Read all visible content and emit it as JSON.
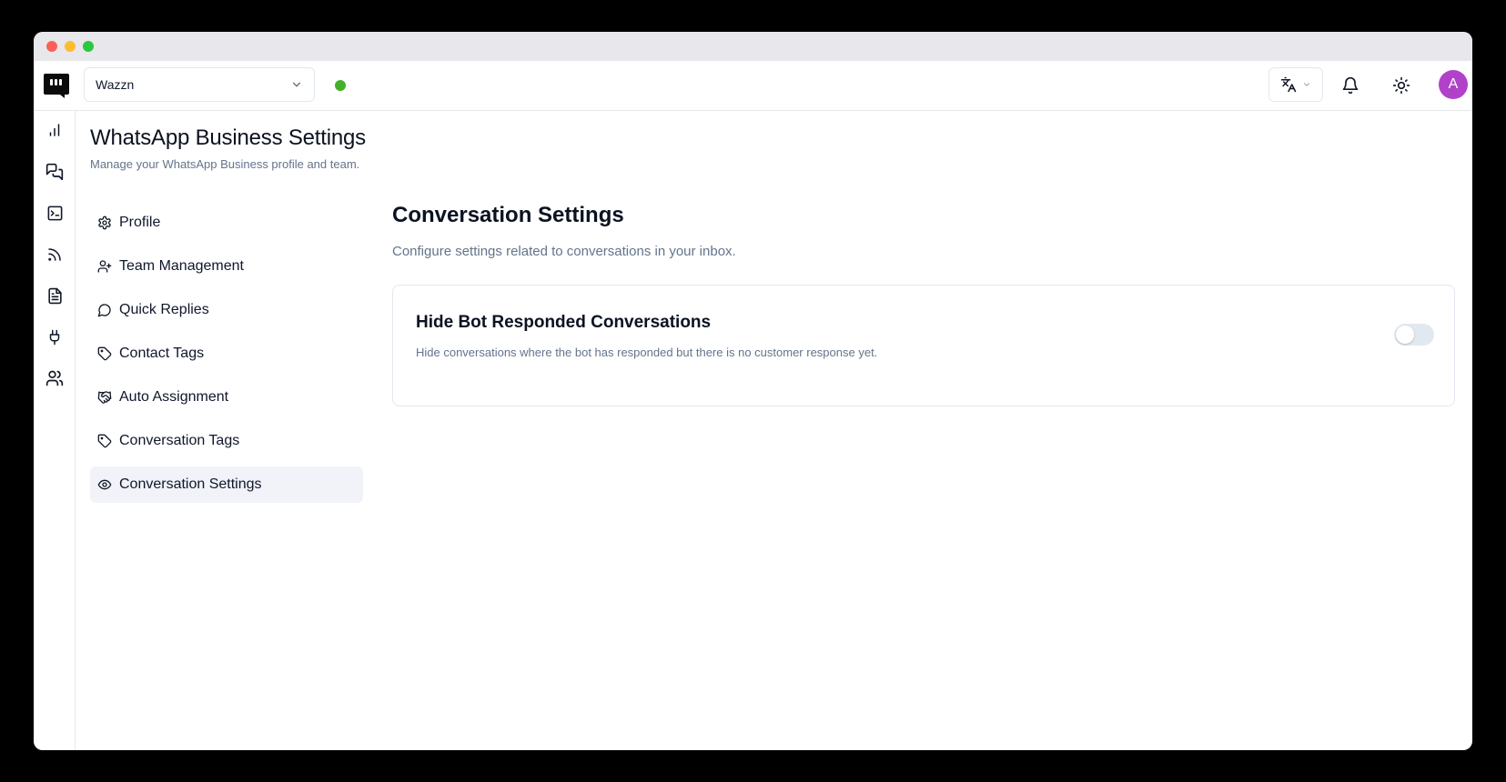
{
  "window": {
    "title_bar_buttons": [
      "close",
      "minimize",
      "zoom"
    ]
  },
  "topbar": {
    "workspace": {
      "value": "Wazzn"
    },
    "status": {
      "online": true,
      "color": "#43b02a"
    },
    "avatar_initial": "A",
    "avatar_color": "#b042c9"
  },
  "rail": {
    "items": [
      "analytics-icon",
      "chats-icon",
      "terminal-icon",
      "feed-icon",
      "document-icon",
      "plug-icon",
      "users-icon"
    ],
    "footer": "settings-gear-icon"
  },
  "page": {
    "title": "WhatsApp Business Settings",
    "subtitle": "Manage your WhatsApp Business profile and team."
  },
  "settings_nav": {
    "items": [
      {
        "label": "Profile",
        "icon": "gear-icon"
      },
      {
        "label": "Team Management",
        "icon": "user-plus-icon"
      },
      {
        "label": "Quick Replies",
        "icon": "message-circle-icon"
      },
      {
        "label": "Contact Tags",
        "icon": "tag-icon"
      },
      {
        "label": "Auto Assignment",
        "icon": "handshake-icon"
      },
      {
        "label": "Conversation Tags",
        "icon": "tag-icon"
      },
      {
        "label": "Conversation Settings",
        "icon": "eye-icon",
        "active": true
      }
    ]
  },
  "section": {
    "title": "Conversation Settings",
    "subtitle": "Configure settings related to conversations in your inbox.",
    "card": {
      "title": "Hide Bot Responded Conversations",
      "description": "Hide conversations where the bot has responded but there is no customer response yet.",
      "toggle_on": false
    }
  }
}
